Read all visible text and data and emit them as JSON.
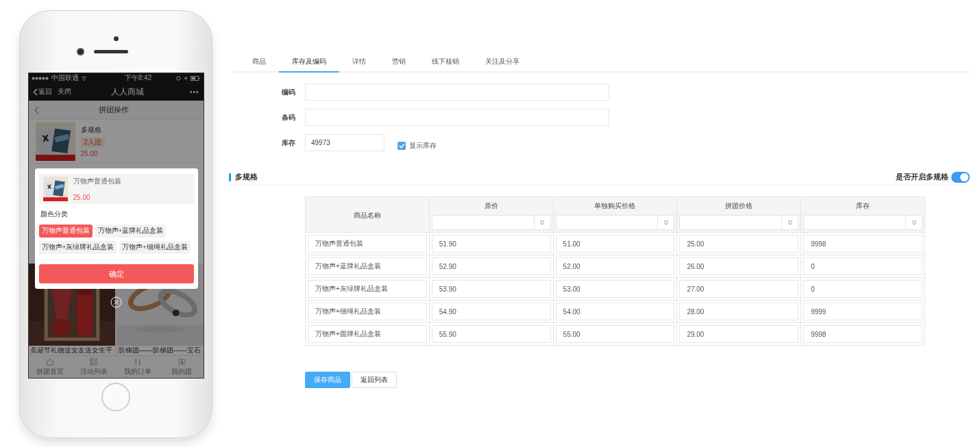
{
  "phone": {
    "status_bar": {
      "carrier": "中国联通",
      "time": "下午8:42"
    },
    "nav_bar": {
      "back": "返回",
      "close": "关闭",
      "title": "人人商城",
      "more": "•••"
    },
    "page_title": "拼团操作",
    "product": {
      "name": "多规格",
      "badge": "2人团",
      "price": "25.00"
    },
    "popup": {
      "product_name": "万物声普通包装",
      "price": "25.00",
      "group_label": "颜色分类",
      "options": [
        {
          "label": "万物声普通包装",
          "selected": true
        },
        {
          "label": "万物声+蓝牌礼品盒装",
          "selected": false
        },
        {
          "label": "万物声+灰绿牌礼品盒装",
          "selected": false
        },
        {
          "label": "万物声+细绳礼品盒装",
          "selected": false
        }
      ],
      "confirm": "确定"
    },
    "tiles": [
      {
        "title": "圣诞节礼物送女友送女生平",
        "kind": "gift"
      },
      {
        "title": "阶梯团——阶梯团——宝石",
        "kind": "rings"
      }
    ],
    "tab_bar": [
      {
        "label": "拼团首页",
        "kind": "home"
      },
      {
        "label": "活动列表",
        "kind": "list"
      },
      {
        "label": "我的订单",
        "kind": "sort"
      },
      {
        "label": "我的团",
        "kind": "people"
      }
    ]
  },
  "tabs": [
    {
      "label": "商品",
      "selected": false
    },
    {
      "label": "库存及编码",
      "selected": true
    },
    {
      "label": "详情",
      "selected": false
    },
    {
      "label": "营销",
      "selected": false
    },
    {
      "label": "线下核销",
      "selected": false
    },
    {
      "label": "关注及分享",
      "selected": false
    }
  ],
  "fields": [
    {
      "label": "编码",
      "kind": "wide"
    },
    {
      "label": "条码",
      "kind": "wide"
    },
    {
      "label": "库存",
      "kind": "stock",
      "value": "49973"
    }
  ],
  "show_stock": {
    "label": "显示库存",
    "checked": true
  },
  "section": {
    "title": "多规格",
    "toggle_label": "是否开启多规格",
    "on": true
  },
  "table": {
    "columns": [
      {
        "title": "商品名称",
        "kind": "plain"
      },
      {
        "title": "原价",
        "kind": "batch"
      },
      {
        "title": "单独购买价格",
        "kind": "batch"
      },
      {
        "title": "拼团价格",
        "kind": "batch"
      },
      {
        "title": "库存",
        "kind": "batch"
      }
    ],
    "rows": [
      [
        "万物声普通包装",
        "51.90",
        "51.00",
        "25.00",
        "9998"
      ],
      [
        "万物声+蓝牌礼品盒装",
        "52.90",
        "52.00",
        "26.00",
        "0"
      ],
      [
        "万物声+灰绿牌礼品盒装",
        "53.90",
        "53.00",
        "27.00",
        "0"
      ],
      [
        "万物声+细绳礼品盒装",
        "54.90",
        "54.00",
        "28.00",
        "9999"
      ],
      [
        "万物声+圆牌礼品盒装",
        "55.90",
        "55.00",
        "29.00",
        "9998"
      ]
    ]
  },
  "buttons": [
    {
      "label": "保存商品",
      "kind": "primary"
    },
    {
      "label": "返回列表",
      "kind": "default"
    }
  ]
}
